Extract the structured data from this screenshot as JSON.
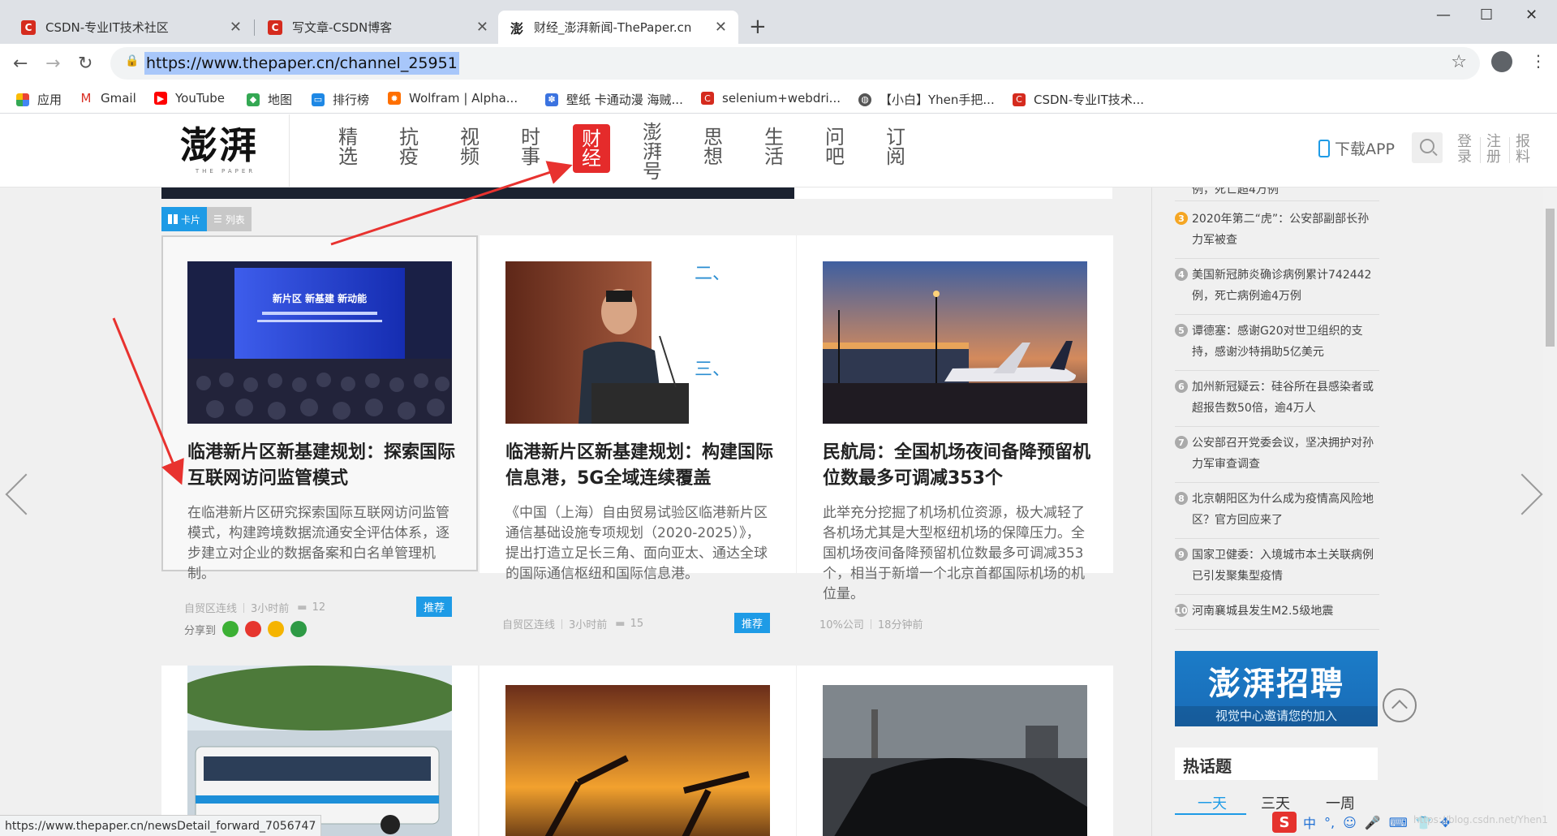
{
  "browser": {
    "tabs": [
      {
        "title": "CSDN-专业IT技术社区",
        "active": false
      },
      {
        "title": "写文章-CSDN博客",
        "active": false
      },
      {
        "title": "财经_澎湃新闻-ThePaper.cn",
        "active": true
      }
    ],
    "url": "https://www.thepaper.cn/channel_25951",
    "bookmarks": [
      {
        "label": "应用",
        "icon": "apps-grid-icon"
      },
      {
        "label": "Gmail",
        "icon": "gmail-icon"
      },
      {
        "label": "YouTube",
        "icon": "youtube-icon"
      },
      {
        "label": "地图",
        "icon": "maps-icon"
      },
      {
        "label": "排行榜",
        "icon": "ranking-icon"
      },
      {
        "label": "Wolfram | Alpha...",
        "icon": "wolfram-icon"
      },
      {
        "label": "壁纸 卡通动漫 海贼...",
        "icon": "paw-icon"
      },
      {
        "label": "selenium+webdri...",
        "icon": "csdn-icon"
      },
      {
        "label": "【小白】Yhen手把...",
        "icon": "globe-icon"
      },
      {
        "label": "CSDN-专业IT技术...",
        "icon": "csdn-icon"
      }
    ],
    "status_url": "https://www.thepaper.cn/newsDetail_forward_7056747"
  },
  "site": {
    "logo_text": "澎湃",
    "logo_sub": "THE PAPER",
    "nav": [
      "精选",
      "抗疫",
      "视频",
      "时事",
      "财经",
      "澎湃号",
      "思想",
      "生活",
      "问吧",
      "订阅"
    ],
    "active_nav": "财经",
    "download_app": "下载APP",
    "login": "登录",
    "register": "注册",
    "report": "报料",
    "view_toggle": {
      "card": "卡片",
      "list": "列表"
    }
  },
  "articles": [
    {
      "title": "临港新片区新基建规划：探索国际互联网访问监管模式",
      "summary": "在临港新片区研究探索国际互联网访问监管模式，构建跨境数据流通安全评估体系，逐步建立对企业的数据备案和白名单管理机制。",
      "source": "自贸区连线",
      "time": "3小时前",
      "comments": "12",
      "badge": "推荐",
      "share_label": "分享到",
      "image_text": "新片区 新基建 新动能"
    },
    {
      "title": "临港新片区新基建规划：构建国际信息港，5G全域连续覆盖",
      "summary": "《中国（上海）自由贸易试验区临港新片区通信基础设施专项规划（2020-2025）》，提出打造立足长三角、面向亚太、通达全球的国际通信枢纽和国际信息港。",
      "source": "自贸区连线",
      "time": "3小时前",
      "comments": "15",
      "badge": "推荐",
      "image_text_1": "二、",
      "image_text_2": "三、"
    },
    {
      "title": "民航局：全国机场夜间备降预留机位数最多可调减353个",
      "summary": "此举充分挖掘了机场机位资源，极大减轻了各机场尤其是大型枢纽机场的保障压力。全国机场夜间备降预留机位数最多可调减353个，相当于新增一个北京首都国际机场的机位量。",
      "source": "10%公司",
      "time": "18分钟前"
    }
  ],
  "sidebar": {
    "ranking_top_fragment": "例，死亡超4万例",
    "ranking": [
      {
        "num": "3",
        "text": "2020年第二“虎”：公安部副部长孙力军被查"
      },
      {
        "num": "4",
        "text": "美国新冠肺炎确诊病例累计742442例，死亡病例逾4万例"
      },
      {
        "num": "5",
        "text": "谭德塞：感谢G20对世卫组织的支持，感谢沙特捐助5亿美元"
      },
      {
        "num": "6",
        "text": "加州新冠疑云：硅谷所在县感染者或超报告数50倍，逾4万人"
      },
      {
        "num": "7",
        "text": "公安部召开党委会议，坚决拥护对孙力军审查调查"
      },
      {
        "num": "8",
        "text": "北京朝阳区为什么成为疫情高风险地区？官方回应来了"
      },
      {
        "num": "9",
        "text": "国家卫健委：入境城市本土关联病例已引发聚集型疫情"
      },
      {
        "num": "10",
        "text": "河南襄城县发生M2.5级地震"
      }
    ],
    "recruit_title": "澎湃招聘",
    "recruit_sub": "视觉中心邀请您的加入",
    "hot_topics": "热话题",
    "hot_tabs": [
      "一天",
      "三天",
      "一周"
    ]
  },
  "ime": {
    "logo": "S",
    "items": [
      "中",
      "°,",
      "☺",
      "🎤",
      "⌨",
      "👕",
      "✥"
    ]
  },
  "watermark": "https://blog.csdn.net/Yhen1",
  "colors": {
    "accent_red": "#e52b2b",
    "accent_blue": "#1e9be6",
    "arrow_red": "#e8322f"
  }
}
